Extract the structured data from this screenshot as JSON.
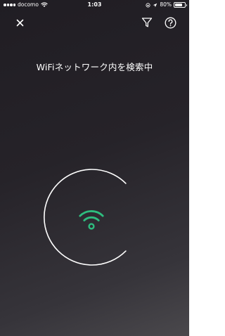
{
  "status_bar": {
    "carrier": "docomo",
    "time": "1:03",
    "battery_percent": "80%",
    "battery_level": 0.8,
    "icons": [
      "signal-icon",
      "wifi-icon",
      "screen-lock-icon",
      "location-icon",
      "battery-icon"
    ]
  },
  "toolbar": {
    "close_icon": "close-icon",
    "filter_icon": "filter-icon",
    "help_icon": "help-icon"
  },
  "main": {
    "title": "WiFiネットワーク内を検索中",
    "scanner_icon": "wifi-icon"
  },
  "colors": {
    "accent": "#2ebd7f",
    "ring": "#ffffff",
    "background_top": "#201d23",
    "background_bottom": "#4a484c"
  }
}
